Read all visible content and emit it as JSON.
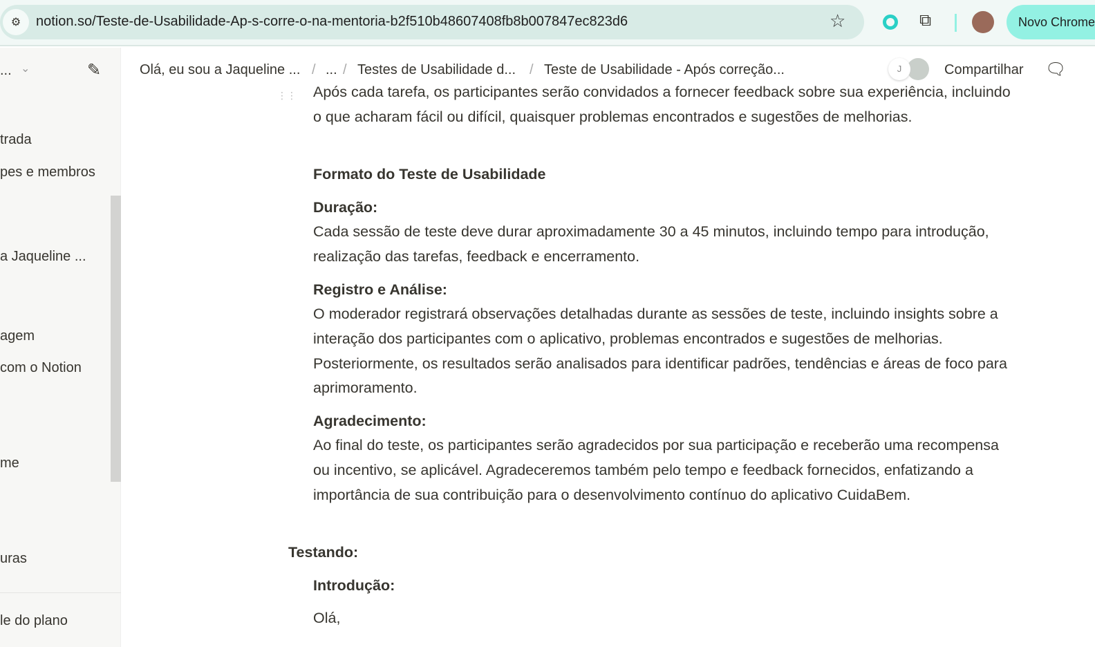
{
  "browser": {
    "url": "notion.so/Teste-de-Usabilidade-Ap-s-corre-o-na-mentoria-b2f510b48607408fb8b007847ec823d6",
    "new_chrome_label": "Novo Chrome"
  },
  "sidebar": {
    "workspace": "...",
    "items": [
      "trada",
      "pes e membros",
      "a Jaqueline ...",
      "agem",
      " com o Notion",
      "me",
      "uras",
      "le do plano"
    ]
  },
  "topbar": {
    "breadcrumbs": [
      "Olá, eu sou a Jaqueline ...",
      "...",
      "Testes de Usabilidade d...",
      "Teste de Usabilidade - Após correção..."
    ],
    "avatar_initial": "J",
    "share_label": "Compartilhar"
  },
  "content": {
    "para_top": "Após cada tarefa, os participantes serão convidados a fornecer feedback sobre sua experiência, incluindo o que acharam fácil ou difícil, quaisquer problemas encontrados e sugestões de melhorias.",
    "format_heading": "Formato do Teste de Usabilidade",
    "duracao_heading": "Duração:",
    "duracao_text": "Cada sessão de teste deve durar aproximadamente 30 a 45 minutos, incluindo tempo para introdução, realização das tarefas, feedback e encerramento.",
    "registro_heading": "Registro e Análise:",
    "registro_text": "O moderador registrará observações detalhadas durante as sessões de teste, incluindo insights sobre a interação dos participantes com o aplicativo, problemas encontrados e sugestões de melhorias. Posteriormente, os resultados serão analisados para identificar padrões, tendências e áreas de foco para aprimoramento.",
    "agradecimento_heading": "Agradecimento:",
    "agradecimento_text": "Ao final do teste, os participantes serão agradecidos por sua participação e receberão uma recompensa ou incentivo, se aplicável. Agradeceremos também pelo tempo e feedback fornecidos, enfatizando a importância de sua contribuição para o desenvolvimento contínuo do aplicativo CuidaBem.",
    "testando_heading": "Testando:",
    "introducao_heading": "Introdução:",
    "ola": "Olá,"
  }
}
